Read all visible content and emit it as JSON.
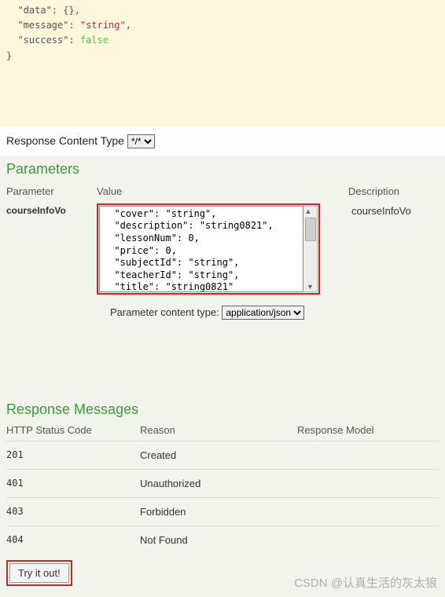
{
  "code_sample": "  \"data\": {},\n  \"message\": \"string\",\n  \"success\": false\n}",
  "response_content_type": {
    "label": "Response Content Type",
    "value": "*/*"
  },
  "parameters_title": "Parameters",
  "params_header": {
    "col1": "Parameter",
    "col2": "Value",
    "col3": "Description"
  },
  "params_row": {
    "name": "courseInfoVo",
    "value": "  \"cover\": \"string\",\n  \"description\": \"string0821\",\n  \"lessonNum\": 0,\n  \"price\": 0,\n  \"subjectId\": \"string\",\n  \"teacherId\": \"string\",\n  \"title\": \"string0821\"",
    "desc": "courseInfoVo"
  },
  "param_content_type": {
    "label": "Parameter content type:",
    "value": "application/json"
  },
  "response_messages_title": "Response Messages",
  "resp_header": {
    "col1": "HTTP Status Code",
    "col2": "Reason",
    "col3": "Response Model"
  },
  "resp_rows": [
    {
      "code": "201",
      "reason": "Created"
    },
    {
      "code": "401",
      "reason": "Unauthorized"
    },
    {
      "code": "403",
      "reason": "Forbidden"
    },
    {
      "code": "404",
      "reason": "Not Found"
    }
  ],
  "try_label": "Try it out!",
  "watermark": "CSDN @认真生活的灰太狼"
}
